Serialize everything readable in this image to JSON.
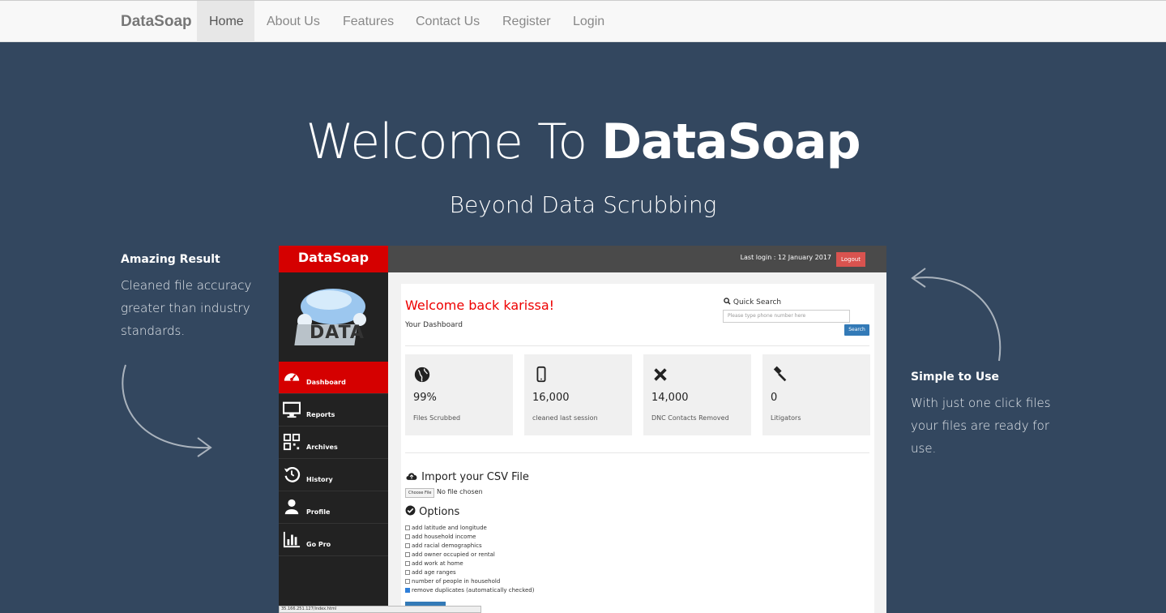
{
  "nav": {
    "brand": "DataSoap",
    "items": [
      "Home",
      "About Us",
      "Features",
      "Contact Us",
      "Register",
      "Login"
    ]
  },
  "hero": {
    "title_light": "Welcome To ",
    "title_bold": "DataSoap",
    "subtitle": "Beyond Data Scrubbing"
  },
  "left": {
    "heading": "Amazing Result",
    "text": [
      "Cleaned file accuracy",
      "greater than industry",
      "standards."
    ]
  },
  "right": {
    "heading": "Simple to Use",
    "text": [
      "With just one click files",
      "your files are ready for",
      "use."
    ]
  },
  "mock": {
    "brand": "DataSoap",
    "logo_word": "DATA",
    "last_login": "Last login : 12 January 2017",
    "logout": "Logout",
    "sidebar": [
      {
        "label": "Dashboard",
        "icon": "dashboard-icon"
      },
      {
        "label": "Reports",
        "icon": "monitor-icon"
      },
      {
        "label": "Archives",
        "icon": "qrcode-icon"
      },
      {
        "label": "History",
        "icon": "history-icon"
      },
      {
        "label": "Profile",
        "icon": "user-icon"
      },
      {
        "label": "Go Pro",
        "icon": "bar-chart-icon"
      }
    ],
    "welcome": "Welcome back karissa!",
    "your_dashboard": "Your Dashboard",
    "quick_search": "Quick Search",
    "search_placeholder": "Please type phone number here",
    "search_btn": "Search",
    "stats": [
      {
        "value": "99%",
        "label": "Files Scrubbed",
        "icon": "globe-icon"
      },
      {
        "value": "16,000",
        "label": "cleaned last session",
        "icon": "mobile-icon"
      },
      {
        "value": "14,000",
        "label": "DNC Contacts Removed",
        "icon": "x-icon"
      },
      {
        "value": "0",
        "label": "Litigators",
        "icon": "gavel-icon"
      }
    ],
    "import_title": "Import your CSV File",
    "choose_file": "Choose File",
    "no_file": "No file chosen",
    "options_title": "Options",
    "options": [
      {
        "label": "add latitude and longitude",
        "checked": false
      },
      {
        "label": "add household income",
        "checked": false
      },
      {
        "label": "add racial demographics",
        "checked": false
      },
      {
        "label": "add owner occupied or rental",
        "checked": false
      },
      {
        "label": "add work at home",
        "checked": false
      },
      {
        "label": "add age ranges",
        "checked": false
      },
      {
        "label": "number of people in household",
        "checked": false
      },
      {
        "label": "remove duplicates (automatically checked)",
        "checked": true
      }
    ],
    "status_url": "35.166.251.127/index.html"
  },
  "colors": {
    "background": "#33475f",
    "accent_red": "#d50000",
    "logout_red": "#d9534f",
    "button_blue": "#337ab7"
  }
}
